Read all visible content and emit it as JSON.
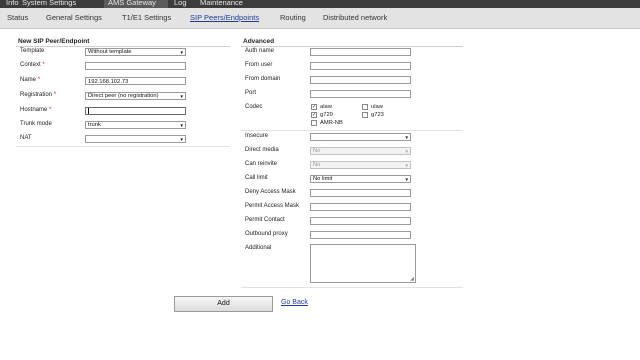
{
  "top_nav": {
    "tabs": [
      {
        "label": "Info"
      },
      {
        "label": "System Settings"
      },
      {
        "label": "AMS Gateway"
      },
      {
        "label": "Log"
      },
      {
        "label": "Maintenance"
      }
    ],
    "active_index": 2
  },
  "sub_nav": {
    "tabs": [
      {
        "label": "Status"
      },
      {
        "label": "General Settings"
      },
      {
        "label": "T1/E1 Settings"
      },
      {
        "label": "SIP Peers/Endpoints"
      },
      {
        "label": "Routing"
      },
      {
        "label": "Distributed network"
      }
    ],
    "active_index": 3
  },
  "left": {
    "title": "New SIP Peer/Endpoint",
    "template_label": "Template",
    "template_value": "Without template",
    "context_label": "Context",
    "context_value": "",
    "name_label": "Name",
    "name_value": "192.168.102.73",
    "registration_label": "Registration",
    "registration_value": "Direct peer (no registration)",
    "hostname_label": "Hostname",
    "hostname_value": "",
    "trunk_label": "Trunk mode",
    "trunk_value": "trunk",
    "nat_label": "NAT",
    "nat_value": "",
    "required_mark": "*"
  },
  "right": {
    "title": "Advanced",
    "auth_label": "Auth name",
    "auth_value": "",
    "fromuser_label": "From user",
    "fromuser_value": "",
    "fromdomain_label": "From domain",
    "fromdomain_value": "",
    "port_label": "Port",
    "port_value": "",
    "codec_label": "Codec",
    "codecs": [
      {
        "label": "alaw",
        "checked": true
      },
      {
        "label": "ulaw",
        "checked": false
      },
      {
        "label": "g729",
        "checked": true
      },
      {
        "label": "g723",
        "checked": false
      },
      {
        "label": "AMR-NB",
        "checked": false
      }
    ],
    "insecure_label": "Insecure",
    "insecure_value": "",
    "directmedia_label": "Direct media",
    "directmedia_value": "No",
    "canreinvite_label": "Can reinvite",
    "canreinvite_value": "No",
    "calllimit_label": "Call limit",
    "calllimit_value": "No limit",
    "deny_label": "Deny Access Mask",
    "deny_value": "",
    "permit_label": "Permit Access Mask",
    "permit_value": "",
    "permitcontact_label": "Permit Contact",
    "permitcontact_value": "",
    "outbound_label": "Outbound proxy",
    "outbound_value": "",
    "additional_label": "Additional",
    "additional_value": ""
  },
  "actions": {
    "add_label": "Add",
    "back_label": "Go Back"
  }
}
